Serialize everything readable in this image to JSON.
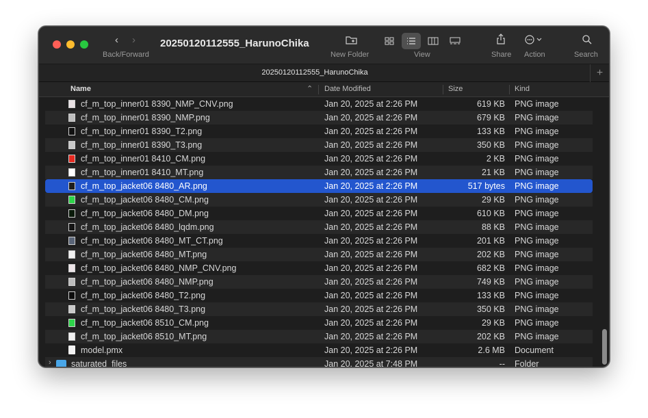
{
  "toolbar": {
    "title": "20250120112555_HarunoChika",
    "back_forward_label": "Back/Forward",
    "new_folder_label": "New Folder",
    "view_label": "View",
    "share_label": "Share",
    "action_label": "Action",
    "search_label": "Search"
  },
  "tab": {
    "title": "20250120112555_HarunoChika",
    "add": "+"
  },
  "columns": {
    "name": "Name",
    "date": "Date Modified",
    "size": "Size",
    "kind": "Kind"
  },
  "files": [
    {
      "name": "cf_m_top_inner01 8390_NMP_CNV.png",
      "date": "Jan 20, 2025 at 2:26 PM",
      "size": "619 KB",
      "kind": "PNG image",
      "thumb": "#e9e1e4"
    },
    {
      "name": "cf_m_top_inner01 8390_NMP.png",
      "date": "Jan 20, 2025 at 2:26 PM",
      "size": "679 KB",
      "kind": "PNG image",
      "thumb": "#bdbdbd"
    },
    {
      "name": "cf_m_top_inner01 8390_T2.png",
      "date": "Jan 20, 2025 at 2:26 PM",
      "size": "133 KB",
      "kind": "PNG image",
      "thumb": "#111111"
    },
    {
      "name": "cf_m_top_inner01 8390_T3.png",
      "date": "Jan 20, 2025 at 2:26 PM",
      "size": "350 KB",
      "kind": "PNG image",
      "thumb": "#c8c8c8"
    },
    {
      "name": "cf_m_top_inner01 8410_CM.png",
      "date": "Jan 20, 2025 at 2:26 PM",
      "size": "2 KB",
      "kind": "PNG image",
      "thumb": "#e62a21"
    },
    {
      "name": "cf_m_top_inner01 8410_MT.png",
      "date": "Jan 20, 2025 at 2:26 PM",
      "size": "21 KB",
      "kind": "PNG image",
      "thumb": "#ffffff"
    },
    {
      "name": "cf_m_top_jacket06 8480_AR.png",
      "date": "Jan 20, 2025 at 2:26 PM",
      "size": "517 bytes",
      "kind": "PNG image",
      "thumb": "#1d1d1d",
      "selected": true
    },
    {
      "name": "cf_m_top_jacket06 8480_CM.png",
      "date": "Jan 20, 2025 at 2:26 PM",
      "size": "29 KB",
      "kind": "PNG image",
      "thumb": "#2ed44a"
    },
    {
      "name": "cf_m_top_jacket06 8480_DM.png",
      "date": "Jan 20, 2025 at 2:26 PM",
      "size": "610 KB",
      "kind": "PNG image",
      "thumb": "#0a1a0a"
    },
    {
      "name": "cf_m_top_jacket06 8480_lqdm.png",
      "date": "Jan 20, 2025 at 2:26 PM",
      "size": "88 KB",
      "kind": "PNG image",
      "thumb": "#141414"
    },
    {
      "name": "cf_m_top_jacket06 8480_MT_CT.png",
      "date": "Jan 20, 2025 at 2:26 PM",
      "size": "201 KB",
      "kind": "PNG image",
      "thumb": "#5a6578"
    },
    {
      "name": "cf_m_top_jacket06 8480_MT.png",
      "date": "Jan 20, 2025 at 2:26 PM",
      "size": "202 KB",
      "kind": "PNG image",
      "thumb": "#f0f0f0"
    },
    {
      "name": "cf_m_top_jacket06 8480_NMP_CNV.png",
      "date": "Jan 20, 2025 at 2:26 PM",
      "size": "682 KB",
      "kind": "PNG image",
      "thumb": "#ece4e7"
    },
    {
      "name": "cf_m_top_jacket06 8480_NMP.png",
      "date": "Jan 20, 2025 at 2:26 PM",
      "size": "749 KB",
      "kind": "PNG image",
      "thumb": "#bcbcbc"
    },
    {
      "name": "cf_m_top_jacket06 8480_T2.png",
      "date": "Jan 20, 2025 at 2:26 PM",
      "size": "133 KB",
      "kind": "PNG image",
      "thumb": "#0d0d0d"
    },
    {
      "name": "cf_m_top_jacket06 8480_T3.png",
      "date": "Jan 20, 2025 at 2:26 PM",
      "size": "350 KB",
      "kind": "PNG image",
      "thumb": "#c9c9c9"
    },
    {
      "name": "cf_m_top_jacket06 8510_CM.png",
      "date": "Jan 20, 2025 at 2:26 PM",
      "size": "29 KB",
      "kind": "PNG image",
      "thumb": "#2ed44a"
    },
    {
      "name": "cf_m_top_jacket06 8510_MT.png",
      "date": "Jan 20, 2025 at 2:26 PM",
      "size": "202 KB",
      "kind": "PNG image",
      "thumb": "#f0f0f0"
    },
    {
      "name": "model.pmx",
      "date": "Jan 20, 2025 at 2:26 PM",
      "size": "2.6 MB",
      "kind": "Document",
      "type": "document"
    },
    {
      "name": "saturated_files",
      "date": "Jan 20, 2025 at 7:48 PM",
      "size": "--",
      "kind": "Folder",
      "type": "folder"
    }
  ],
  "colors": {
    "selection": "#2356ce",
    "window_bg": "#1e1e1e",
    "toolbar_bg": "#2b2b2b"
  }
}
